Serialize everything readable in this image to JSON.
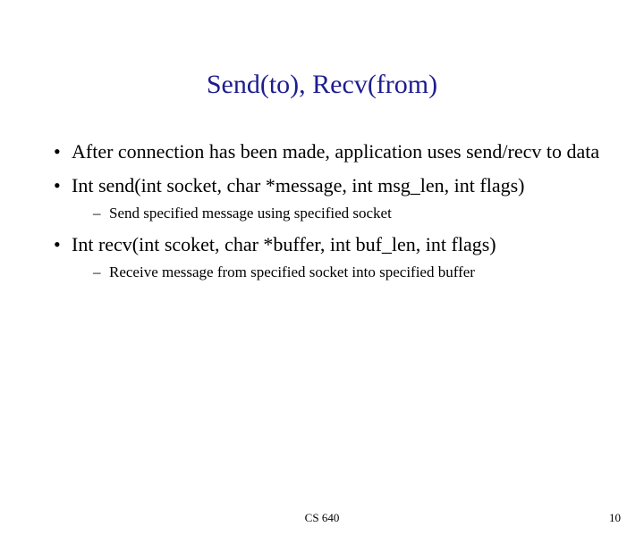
{
  "title": "Send(to), Recv(from)",
  "bullets": {
    "b1": "After connection has been made, application uses send/recv to data",
    "b2": "Int send(int socket, char *message, int msg_len, int flags)",
    "b2sub": "Send specified message using specified socket",
    "b3": "Int recv(int scoket, char *buffer, int buf_len, int flags)",
    "b3sub": "Receive message from specified socket into specified buffer"
  },
  "footer": {
    "center": "CS 640",
    "page": "10"
  }
}
